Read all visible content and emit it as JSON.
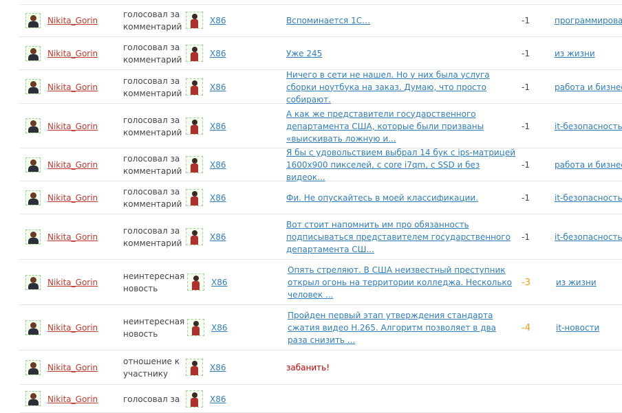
{
  "rows": [
    {
      "user": "Nikita_Gorin",
      "action": "голосовал за комментарий",
      "target": "X86",
      "comment": "Вспоминается 1С…",
      "score": "-1",
      "tag": "программирование"
    },
    {
      "user": "Nikita_Gorin",
      "action": "голосовал за комментарий",
      "target": "X86",
      "comment": "Уже 245",
      "score": "-1",
      "tag": "из жизни"
    },
    {
      "user": "Nikita_Gorin",
      "action": "голосовал за комментарий",
      "target": "X86",
      "comment": "Ничего в сети не нашел. Но у них была услуга сборки ноутбука на заказ. Думаю, что просто собирают.",
      "score": "-1",
      "tag": "работа и бизнес"
    },
    {
      "user": "Nikita_Gorin",
      "action": "голосовал за комментарий",
      "target": "X86",
      "comment": "А как же представители государственного департамента США, которые были призваны «выискивать ложную и...",
      "score": "-1",
      "tag": "it-безопасность"
    },
    {
      "user": "Nikita_Gorin",
      "action": "голосовал за комментарий",
      "target": "X86",
      "comment": "Я бы с удовольствием выбрал 14 бук с ips-матрицей 1600x900 пикселей, с core i7qm, с SSD и без видеок...",
      "score": "-1",
      "tag": "работа и бизнес"
    },
    {
      "user": "Nikita_Gorin",
      "action": "голосовал за комментарий",
      "target": "X86",
      "comment": "Фи. Не опускайтесь в моей классификации.",
      "score": "-1",
      "tag": "it-безопасность"
    },
    {
      "user": "Nikita_Gorin",
      "action": "голосовал за комментарий",
      "target": "X86",
      "comment": "Вот стоит напомнить им про обязанность подписываться представителем государственного департамента СШ...",
      "score": "-1",
      "tag": "it-безопасность"
    },
    {
      "user": "Nikita_Gorin",
      "action": "неинтересная новость",
      "target": "X86",
      "comment": "Опять стреляют. В США неизвестный преступник открыл огонь на территории колледжа. Несколько человек ...",
      "score": "-3",
      "tag": "из жизни"
    },
    {
      "user": "Nikita_Gorin",
      "action": "неинтересная новость",
      "target": "X86",
      "comment": "Пройден первый этап утверждения стандарта сжатия видео H.265. Алгоритм позволяет в два раза снизить ...",
      "score": "-4",
      "tag": "it-новости"
    },
    {
      "user": "Nikita_Gorin",
      "action": "отношение к участнику",
      "target": "X86",
      "comment": "забанить!",
      "score": "",
      "tag": ""
    },
    {
      "user": "Nikita_Gorin",
      "action": "голосовал за",
      "target": "X86",
      "comment": "",
      "score": "",
      "tag": ""
    }
  ],
  "colors": {
    "user_link": "#c0392b",
    "link": "#2f7dbd",
    "negative_score": "#f39c12",
    "ban": "#cc0000"
  }
}
